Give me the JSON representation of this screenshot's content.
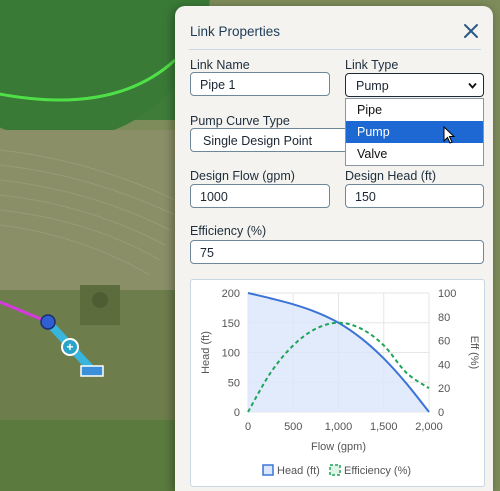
{
  "panel": {
    "title": "Link Properties"
  },
  "link_name": {
    "label": "Link Name",
    "value": "Pipe 1"
  },
  "link_type": {
    "label": "Link Type",
    "value": "Pump",
    "options": [
      "Pipe",
      "Pump",
      "Valve"
    ],
    "highlighted": "Pump"
  },
  "pump_curve": {
    "label": "Pump Curve Type",
    "value": "Single Design Point"
  },
  "design_flow": {
    "label": "Design Flow (gpm)",
    "value": "1000"
  },
  "design_head": {
    "label": "Design Head (ft)",
    "value": "150"
  },
  "efficiency": {
    "label": "Efficiency (%)",
    "value": "75"
  },
  "colors": {
    "accent": "#1e68d4",
    "head_line": "#3b74d6",
    "eff_line": "#1fa55a",
    "head_fill": "#dbe6fb"
  },
  "chart_data": {
    "type": "line",
    "xlabel": "Flow (gpm)",
    "ylabel": "Head (ft)",
    "y2label": "Eff (%)",
    "xlim": [
      0,
      2000
    ],
    "ylim": [
      0,
      200
    ],
    "y2lim": [
      0,
      100
    ],
    "x_ticks": [
      "0",
      "500",
      "1,000",
      "1,500",
      "2,000"
    ],
    "y_ticks": [
      "0",
      "50",
      "100",
      "150",
      "200"
    ],
    "y2_ticks": [
      "0",
      "20",
      "40",
      "60",
      "80",
      "100"
    ],
    "legend_position": "bottom",
    "series": [
      {
        "name": "Head (ft)",
        "axis": "left",
        "style": "solid",
        "filled": true,
        "x": [
          0,
          250,
          500,
          750,
          1000,
          1250,
          1500,
          1750,
          2000
        ],
        "y": [
          200,
          191,
          181,
          168,
          150,
          124,
          90,
          48,
          0
        ]
      },
      {
        "name": "Efficiency (%)",
        "axis": "right",
        "style": "dashed",
        "x": [
          0,
          250,
          500,
          750,
          1000,
          1250,
          1500,
          1750,
          2000
        ],
        "y": [
          0,
          33,
          56,
          70,
          75,
          70,
          56,
          33,
          20
        ]
      }
    ]
  }
}
